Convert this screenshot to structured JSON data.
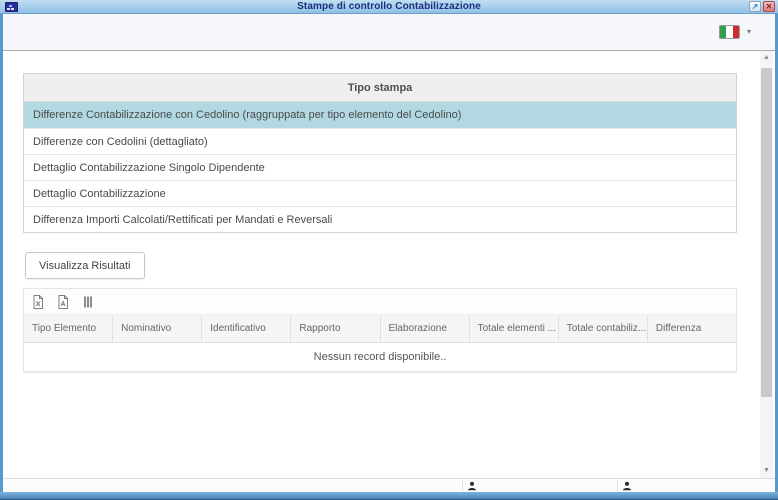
{
  "window": {
    "title": "Stampe di controllo Contabilizzazione",
    "restore_glyph": "↗",
    "close_glyph": "✕"
  },
  "toolbar": {
    "language": "italiano",
    "language_caret": "▾"
  },
  "tipo_stampa": {
    "header": "Tipo stampa",
    "rows": [
      {
        "label": "Differenze Contabilizzazione con Cedolino (raggruppata per tipo elemento del Cedolino)",
        "selected": true
      },
      {
        "label": "Differenze con Cedolini (dettagliato)",
        "selected": false
      },
      {
        "label": "Dettaglio Contabilizzazione Singolo Dipendente",
        "selected": false
      },
      {
        "label": "Dettaglio Contabilizzazione",
        "selected": false
      },
      {
        "label": "Differenza Importi Calcolati/Rettificati per Mandati e Reversali",
        "selected": false
      }
    ]
  },
  "actions": {
    "visualizza_risultati": "Visualizza Risultati"
  },
  "results_grid": {
    "toolbar_icons": [
      {
        "name": "export-excel-icon"
      },
      {
        "name": "export-pdf-icon"
      },
      {
        "name": "columns-icon"
      }
    ],
    "columns": [
      "Tipo Elemento",
      "Nominativo",
      "Identificativo",
      "Rapporto",
      "Elaborazione",
      "Totale elementi ...",
      "Totale contabiliz...",
      "Differenza"
    ],
    "empty_message": "Nessun record disponibile.."
  },
  "footer": {
    "user_icons": [
      "user-icon",
      "user-icon"
    ]
  },
  "scrollbar": {
    "up_glyph": "▲",
    "down_glyph": "▼"
  },
  "colors": {
    "frame": "#569ace",
    "frame_dark": "#39719f",
    "titlebar_top": "#c2ddf2",
    "titlebar_bottom": "#8fc0e6",
    "title_text": "#1b2f7e",
    "selected_row": "#b2d9e2",
    "close_button": "#dd7f7f",
    "flag_green": "#2e9e4f",
    "flag_white": "#ffffff",
    "flag_red": "#ce2b37"
  }
}
